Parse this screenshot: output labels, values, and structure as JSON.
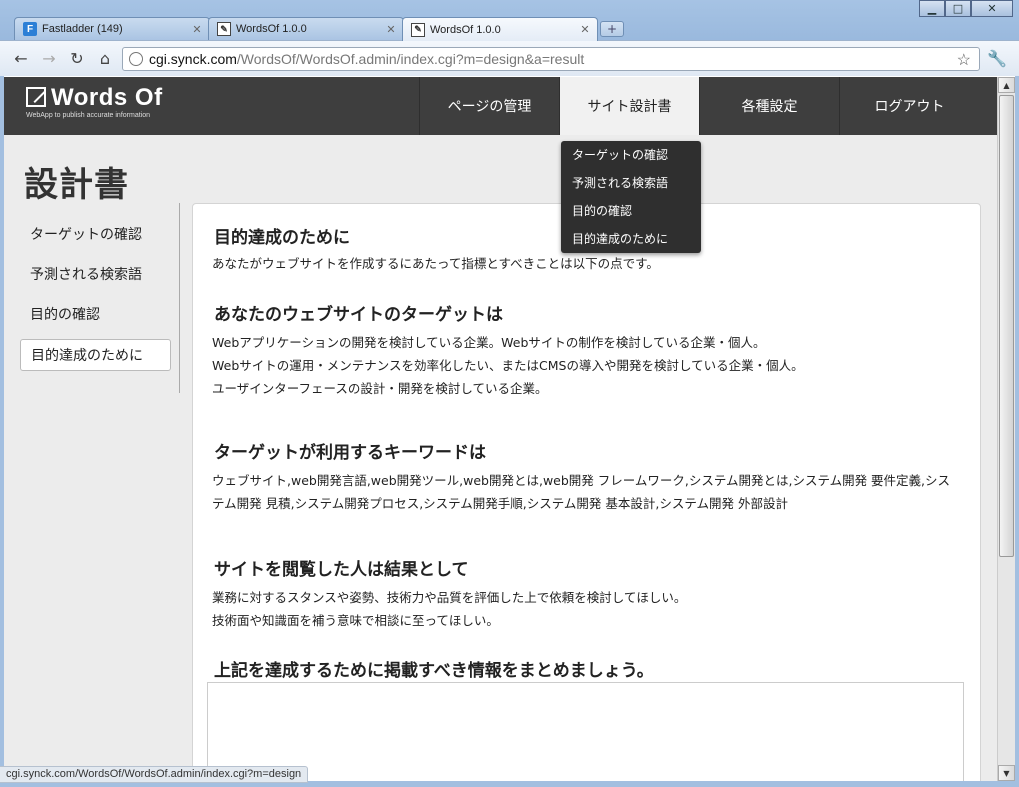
{
  "browser": {
    "tabs": [
      {
        "title": "Fastladder (149)",
        "icon": "fastladder-icon"
      },
      {
        "title": "WordsOf 1.0.0",
        "icon": "wordsof-icon"
      },
      {
        "title": "WordsOf 1.0.0",
        "icon": "wordsof-icon"
      }
    ],
    "active_tab": 2,
    "url_host": "cgi.synck.com",
    "url_path": "/WordsOf/WordsOf.admin/index.cgi?m=design&a=result",
    "status_url": "cgi.synck.com/WordsOf/WordsOf.admin/index.cgi?m=design"
  },
  "app": {
    "logo_name": "Words Of",
    "logo_tagline": "WebApp to publish accurate information",
    "nav": [
      "ページの管理",
      "サイト設計書",
      "各種設定",
      "ログアウト"
    ],
    "active_nav": 1,
    "dropdown": [
      "ターゲットの確認",
      "予測される検索語",
      "目的の確認",
      "目的達成のために"
    ]
  },
  "page": {
    "title": "設計書",
    "sidenav": [
      "ターゲットの確認",
      "予測される検索語",
      "目的の確認",
      "目的達成のために"
    ],
    "active_side": 3
  },
  "content": {
    "s1_heading": "目的達成のために",
    "s1_text": "あなたがウェブサイトを作成するにあたって指標とすべきことは以下の点です。",
    "s2_heading": "あなたのウェブサイトのターゲットは",
    "s2_lines": [
      "Webアプリケーションの開発を検討している企業。Webサイトの制作を検討している企業・個人。",
      "Webサイトの運用・メンテナンスを効率化したい、またはCMSの導入や開発を検討している企業・個人。",
      "ユーザインターフェースの設計・開発を検討している企業。"
    ],
    "s3_heading": "ターゲットが利用するキーワードは",
    "s3_text": "ウェブサイト,web開発言語,web開発ツール,web開発とは,web開発 フレームワーク,システム開発とは,システム開発 要件定義,システム開発 見積,システム開発プロセス,システム開発手順,システム開発 基本設計,システム開発 外部設計",
    "s4_heading": "サイトを閲覧した人は結果として",
    "s4_lines": [
      "業務に対するスタンスや姿勢、技術力や品質を評価した上で依頼を検討してほしい。",
      "技術面や知識面を補う意味で相談に至ってほしい。"
    ],
    "s5_heading": "上記を達成するために掲載すべき情報をまとめましょう。",
    "textarea_value": ""
  }
}
